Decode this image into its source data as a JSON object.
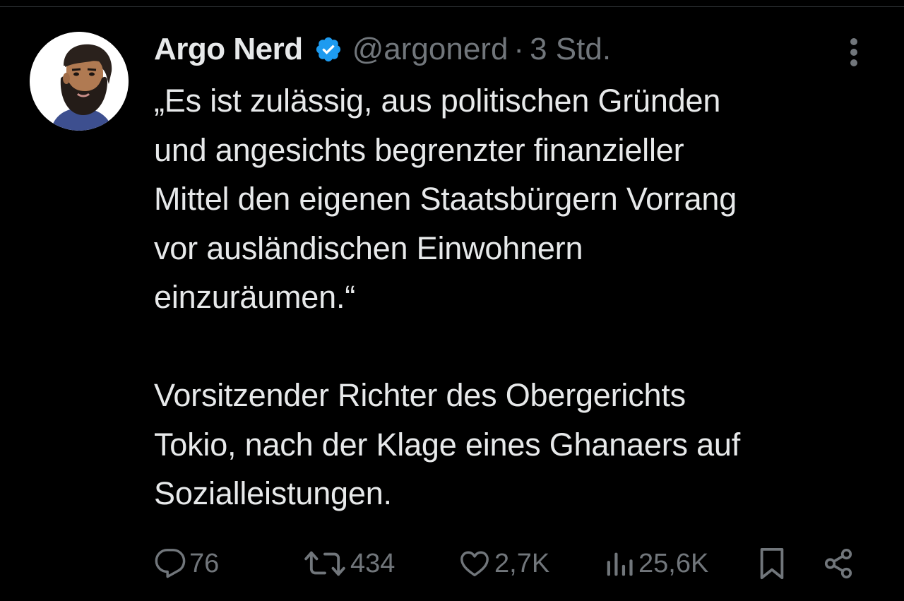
{
  "tweet": {
    "author": {
      "display_name": "Argo Nerd",
      "handle": "@argonerd",
      "verified": true,
      "avatar_icon": "bearded-man-avatar"
    },
    "separator": "·",
    "time": "3 Std.",
    "more_icon": "more-vertical-icon",
    "body": {
      "quote_lines": [
        "„Es ist zulässig, aus politischen Gründen",
        "und angesichts begrenzter finanzieller",
        "Mittel den eigenen Staatsbürgern Vorrang",
        "vor ausländischen Einwohnern",
        "einzuräumen.“"
      ],
      "attribution_lines": [
        "Vorsitzender Richter des Obergerichts",
        "Tokio, nach der Klage eines Ghanaers auf",
        "Sozialleistungen."
      ]
    },
    "actions": {
      "reply": {
        "icon": "reply-icon",
        "count": "76"
      },
      "retweet": {
        "icon": "retweet-icon",
        "count": "434"
      },
      "like": {
        "icon": "heart-icon",
        "count": "2,7K"
      },
      "views": {
        "icon": "views-chart-icon",
        "count": "25,6K"
      },
      "bookmark": {
        "icon": "bookmark-icon"
      },
      "share": {
        "icon": "share-icon"
      }
    },
    "colors": {
      "background": "#000000",
      "primary_text": "#e7e9ea",
      "secondary_text": "#71767b",
      "verified_blue": "#1d9bf0"
    }
  }
}
